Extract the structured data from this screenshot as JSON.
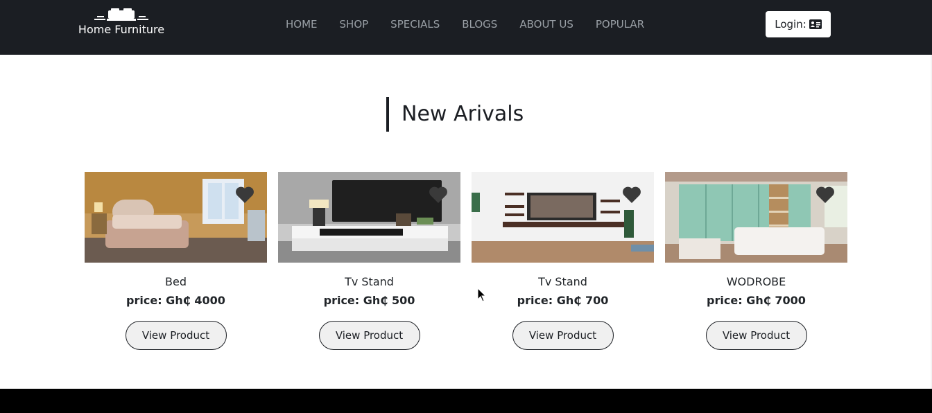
{
  "navbar": {
    "brand": "Home Furniture",
    "links": [
      "HOME",
      "SHOP",
      "SPECIALS",
      "BLOGS",
      "ABOUT US",
      "POPULAR"
    ],
    "login_label": "Login:",
    "login_icon": "id-card-icon"
  },
  "section": {
    "title": "New Arivals"
  },
  "products": [
    {
      "name": "Bed",
      "price": "price: Gh₵ 4000",
      "button": "View Product",
      "icon": "heart-icon"
    },
    {
      "name": "Tv Stand",
      "price": "price: Gh₵ 500",
      "button": "View Product",
      "icon": "heart-icon"
    },
    {
      "name": "Tv Stand",
      "price": "price: Gh₵ 700",
      "button": "View Product",
      "icon": "heart-icon"
    },
    {
      "name": "WODROBE",
      "price": "price: Gh₵ 7000",
      "button": "View Product",
      "icon": "heart-icon"
    }
  ],
  "colors": {
    "navbar_bg": "#1b1e23",
    "nav_link": "#9aa0a6",
    "footer_bg": "#000000",
    "button_bg": "#f0f0f0"
  }
}
